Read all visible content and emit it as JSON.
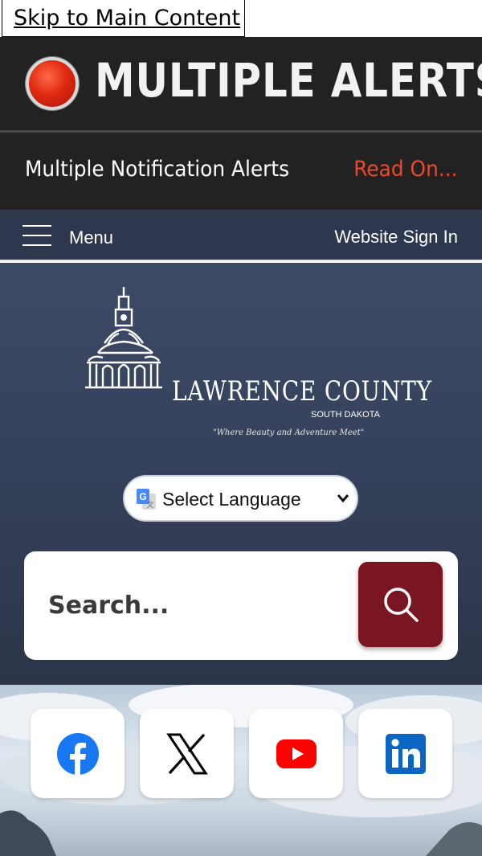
{
  "skip_link": "Skip to Main Content",
  "alert": {
    "title": "MULTIPLE ALERTS",
    "notification": "Multiple Notification Alerts",
    "read_on": "Read On..."
  },
  "nav": {
    "menu_label": "Menu",
    "sign_in": "Website Sign In"
  },
  "logo": {
    "name": "LAWRENCE COUNTY",
    "state": "SOUTH DAKOTA",
    "tagline": "\"Where Beauty and Adventure Meet\""
  },
  "language": {
    "selected": "Select Language"
  },
  "search": {
    "placeholder": "Search..."
  },
  "social": [
    "facebook-icon",
    "x-icon",
    "youtube-icon",
    "linkedin-icon"
  ],
  "colors": {
    "alert_bg": "#222222",
    "alert_accent": "#ea4a2c",
    "nav_bg": "#2d374d",
    "search_button": "#7a1621"
  }
}
